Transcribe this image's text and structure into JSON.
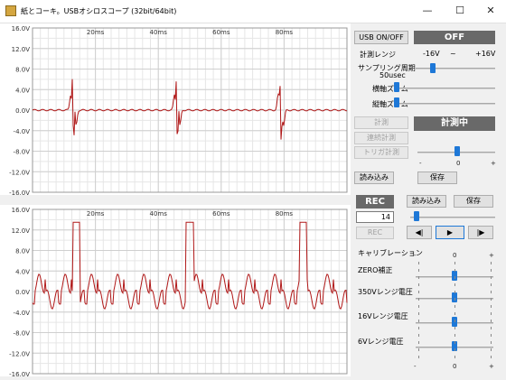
{
  "window": {
    "title": "紙とコーキ。USBオシロスコープ (32bit/64bit)",
    "minimize": "—",
    "maximize": "☐",
    "close": "✕"
  },
  "scope_top": {
    "y_ticks": [
      "16.0V",
      "12.0V",
      "8.0V",
      "4.0V",
      "0.0V",
      "-4.0V",
      "-8.0V",
      "-12.0V",
      "-16.0V"
    ],
    "x_ticks": [
      "20ms",
      "40ms",
      "60ms",
      "80ms"
    ],
    "trace_color": "#b01818"
  },
  "scope_bottom": {
    "y_ticks": [
      "16.0V",
      "12.0V",
      "8.0V",
      "4.0V",
      "0.0V",
      "-4.0V",
      "-8.0V",
      "-12.0V",
      "-16.0V"
    ],
    "x_ticks": [
      "20ms",
      "40ms",
      "60ms",
      "80ms"
    ],
    "trace_color": "#b01818"
  },
  "controls": {
    "usb_button": "USB ON/OFF",
    "usb_status": "OFF",
    "range_label": "計測レンジ",
    "range_min": "-16V",
    "range_sep": "~",
    "range_max": "+16V",
    "sampling_label": "サンプリング周期",
    "sampling_value": "50usec",
    "h_zoom_label": "横軸ズーム",
    "v_zoom_label": "縦軸ズーム",
    "measure_button": "計測",
    "measure_status": "計測中",
    "continuous_button": "連続計測",
    "trigger_button": "トリガ計測",
    "offset_minus": "-",
    "offset_zero": "0",
    "offset_plus": "+",
    "load_button": "読み込み",
    "save_button": "保存"
  },
  "rec": {
    "rec_label": "REC",
    "load_button": "読み込み",
    "save_button": "保存",
    "count_value": "14",
    "rec_button": "REC",
    "prev_icon": "◀|",
    "play_icon": "▶",
    "next_icon": "|▶"
  },
  "calibration": {
    "title": "キャリブレーション",
    "scale_top": [
      "-",
      "0",
      "+"
    ],
    "items": [
      "ZERO補正",
      "350Vレンジ電圧",
      "16Vレンジ電圧",
      "6Vレンジ電圧"
    ],
    "scale_bottom": [
      "-",
      "0",
      "+"
    ]
  }
}
